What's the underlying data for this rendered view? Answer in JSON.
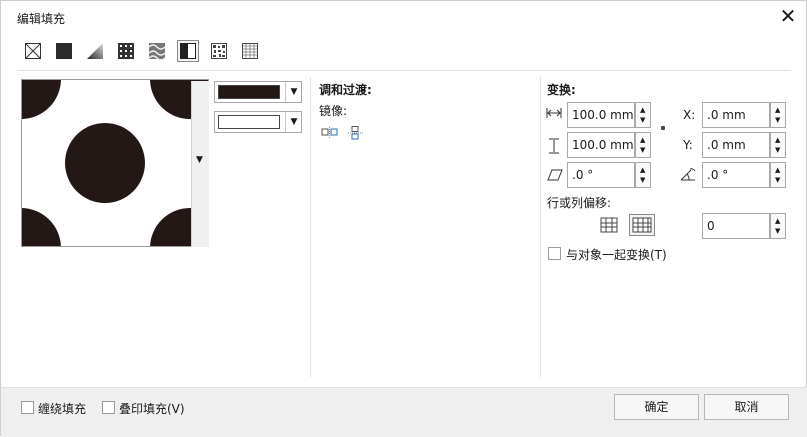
{
  "dialog": {
    "title": "编辑填充",
    "close_glyph": "✕"
  },
  "fill_types": [
    "no-fill",
    "uniform-fill",
    "fountain-fill",
    "vector-pattern-fill",
    "bitmap-pattern-fill",
    "two-color-pattern-fill",
    "texture-fill",
    "postscript-fill"
  ],
  "colors": {
    "foreground": "#231816",
    "background": "#ffffff"
  },
  "blend": {
    "title": "调和过渡:",
    "mirror_label": "镜像:"
  },
  "transform": {
    "title": "变换:",
    "width": "100.0 mm",
    "height": "100.0 mm",
    "x_label": "X:",
    "x_value": ".0 mm",
    "y_label": "Y:",
    "y_value": ".0 mm",
    "skew": ".0 °",
    "rotate": ".0 °",
    "row_col_offset_label": "行或列偏移:",
    "offset_value": "0",
    "transform_with_object": "与对象一起变换(T)"
  },
  "footer": {
    "wrap_fill": "缠绕填充",
    "overprint_fill": "叠印填充(V)",
    "ok": "确定",
    "cancel": "取消"
  }
}
